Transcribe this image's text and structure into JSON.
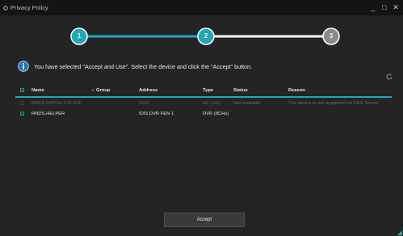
{
  "window": {
    "title": "Privacy Policy",
    "minimize": "_",
    "restore": "□",
    "close": "✕"
  },
  "stepper": {
    "steps": [
      "1",
      "2",
      "3"
    ],
    "active_step": 2
  },
  "info": {
    "message": "You have selected \"Accept and Use\". Select the device and click the \"Accept\" button."
  },
  "table": {
    "columns": {
      "name": "Name",
      "group": "Group",
      "address": "Address",
      "type": "Type",
      "status": "Status",
      "reason": "Reason"
    },
    "rows": [
      {
        "name": "RNDS.RATOU-124.209",
        "group": "",
        "address": "RDS",
        "type": "HF-1101",
        "status": "Not available",
        "reason": "The device is not registered on FEN Server.",
        "checked": false,
        "enabled": false
      },
      {
        "name": "RNDS.HELPER",
        "group": "",
        "address": "IDIS DVR FEN 1",
        "type": "DVR (8CHs)",
        "status": "",
        "reason": "",
        "checked": true,
        "enabled": true
      }
    ]
  },
  "footer": {
    "accept_label": "Accept"
  },
  "colors": {
    "accent": "#20a8b6",
    "step_pending": "#8a8a8a",
    "background": "#242424"
  },
  "icons": {
    "app": "gear-icon",
    "info": "info-icon",
    "refresh": "refresh-icon",
    "sort": "sort-arrow-icon",
    "grip": "resize-grip-icon"
  }
}
